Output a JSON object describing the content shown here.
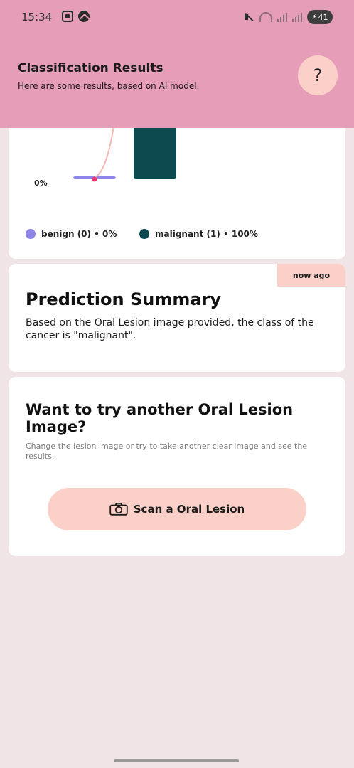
{
  "status_bar": {
    "time": "15:34",
    "battery": "41",
    "icons": [
      "screenshot-icon",
      "nav-icon",
      "mute-icon",
      "wifi-icon",
      "signal-icon",
      "battery-icon"
    ]
  },
  "header": {
    "title": "Classification Results",
    "subtitle": "Here are some results, based on AI model.",
    "help_label": "?"
  },
  "chart_data": {
    "type": "bar",
    "categories": [
      "benign (0)",
      "malignant (1)"
    ],
    "values": [
      0,
      100
    ],
    "y_tick_visible": "0%",
    "ylim": [
      0,
      100
    ],
    "colors": [
      "#8e86e8",
      "#0c4a50"
    ],
    "legend": [
      {
        "label": "benign (0) • 0%",
        "color": "#8e86e8"
      },
      {
        "label": "malignant (1) • 100%",
        "color": "#0c4a50"
      }
    ]
  },
  "summary": {
    "badge": "now ago",
    "title": "Prediction Summary",
    "text": "Based on the Oral Lesion image provided, the class of the cancer is \"malignant\"."
  },
  "try_again": {
    "title": "Want to try another Oral Lesion Image?",
    "subtitle": "Change the lesion image or try to take another clear image and see the results.",
    "button_label": "Scan a Oral Lesion"
  },
  "colors": {
    "header_bg": "#e59db8",
    "page_bg": "#f1e4e6",
    "accent": "#fbd0c8",
    "benign": "#8e86e8",
    "malignant": "#0c4a50"
  }
}
